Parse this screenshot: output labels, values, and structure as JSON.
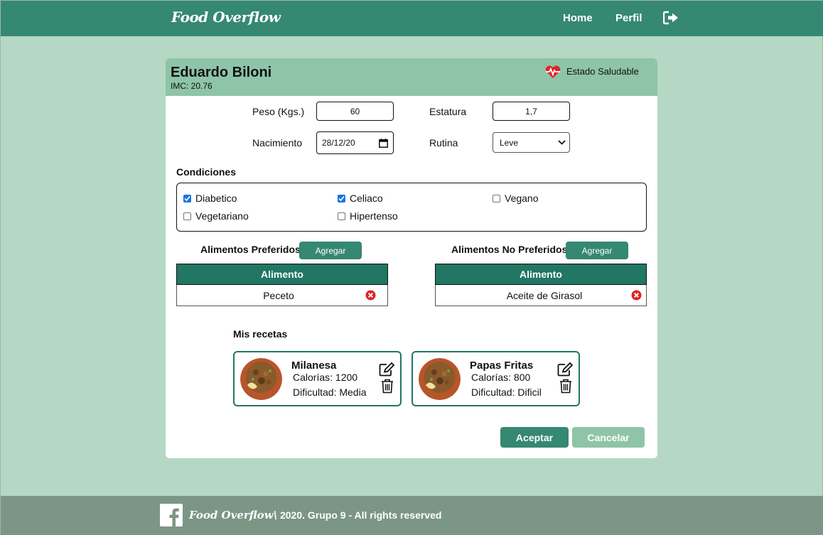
{
  "nav": {
    "brand": "Food Overflow",
    "home": "Home",
    "perfil": "Perfil",
    "logout_icon": "sign-out-icon"
  },
  "profile": {
    "name": "Eduardo Biloni",
    "imc": "IMC: 20.76",
    "health_status": "Estado Saludable",
    "health_icon": "heartbeat-icon",
    "health_color": "#e02424"
  },
  "form": {
    "peso_label": "Peso (Kgs.)",
    "peso_value": "60",
    "estatura_label": "Estatura",
    "estatura_value": "1,7",
    "nacimiento_label": "Nacimiento",
    "nacimiento_value": "28/12/20",
    "rutina_label": "Rutina",
    "rutina_value": "Leve"
  },
  "conditions": {
    "title": "Condiciones",
    "items": [
      {
        "label": "Diabetico",
        "checked": true
      },
      {
        "label": "Celiaco",
        "checked": true
      },
      {
        "label": "Vegano",
        "checked": false
      },
      {
        "label": "Vegetariano",
        "checked": false
      },
      {
        "label": "Hipertenso",
        "checked": false
      }
    ]
  },
  "preferred": {
    "title": "Alimentos Preferidos",
    "add_label": "Agregar",
    "column": "Alimento",
    "rows": [
      "Peceto"
    ]
  },
  "not_preferred": {
    "title": "Alimentos No Preferidos",
    "add_label": "Agregar",
    "column": "Alimento",
    "rows": [
      "Aceite de Girasol"
    ]
  },
  "recipes": {
    "title": "Mis recetas",
    "items": [
      {
        "name": "Milanesa",
        "calories": "Calorías: 1200",
        "difficulty": "Dificultad: Media"
      },
      {
        "name": "Papas Fritas",
        "calories": "Calorías: 800",
        "difficulty": "Dificultad: Dificil"
      }
    ]
  },
  "actions": {
    "accept": "Aceptar",
    "cancel": "Cancelar"
  },
  "footer": {
    "brand": "Food Overflow\\",
    "text": " 2020. Grupo 9 - All rights reserved",
    "icon": "facebook-icon"
  },
  "colors": {
    "primary": "#358872",
    "header": "#8ec4a7",
    "background": "#b4d8c4",
    "table_head": "#217664",
    "footer": "#7c9686",
    "delete": "#e02424"
  }
}
